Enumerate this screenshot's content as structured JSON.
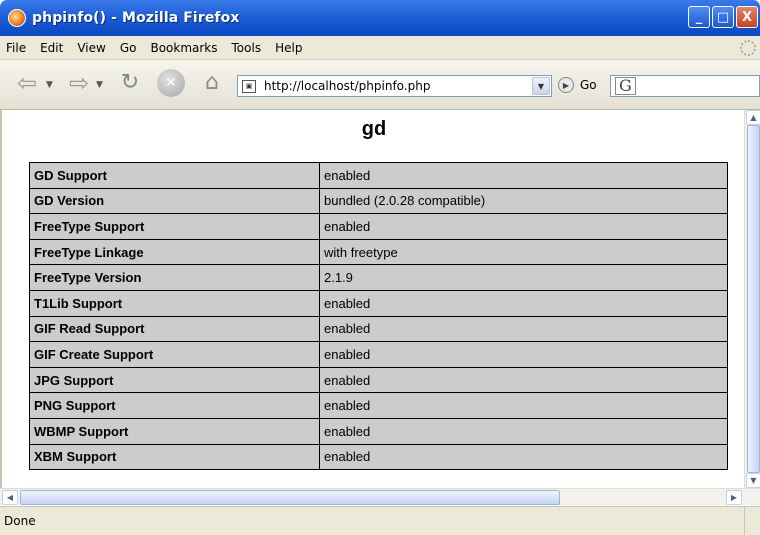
{
  "window": {
    "title": "phpinfo() - Mozilla Firefox",
    "buttons": {
      "minimize": "_",
      "maximize": "□",
      "close": "X"
    }
  },
  "menu": [
    "File",
    "Edit",
    "View",
    "Go",
    "Bookmarks",
    "Tools",
    "Help"
  ],
  "toolbar": {
    "url": "http://localhost/phpinfo.php",
    "go_label": "Go",
    "search_logo": "G"
  },
  "page": {
    "heading": "gd",
    "rows": [
      {
        "name": "GD Support",
        "value": "enabled"
      },
      {
        "name": "GD Version",
        "value": "bundled (2.0.28 compatible)"
      },
      {
        "name": "FreeType Support",
        "value": "enabled"
      },
      {
        "name": "FreeType Linkage",
        "value": "with freetype"
      },
      {
        "name": "FreeType Version",
        "value": "2.1.9"
      },
      {
        "name": "T1Lib Support",
        "value": "enabled"
      },
      {
        "name": "GIF Read Support",
        "value": "enabled"
      },
      {
        "name": "GIF Create Support",
        "value": "enabled"
      },
      {
        "name": "JPG Support",
        "value": "enabled"
      },
      {
        "name": "PNG Support",
        "value": "enabled"
      },
      {
        "name": "WBMP Support",
        "value": "enabled"
      },
      {
        "name": "XBM Support",
        "value": "enabled"
      }
    ]
  },
  "status": {
    "text": "Done"
  },
  "colors": {
    "titlebar": "#1e5fd8",
    "chrome": "#ece9d8",
    "table_cell": "#cccccc"
  }
}
